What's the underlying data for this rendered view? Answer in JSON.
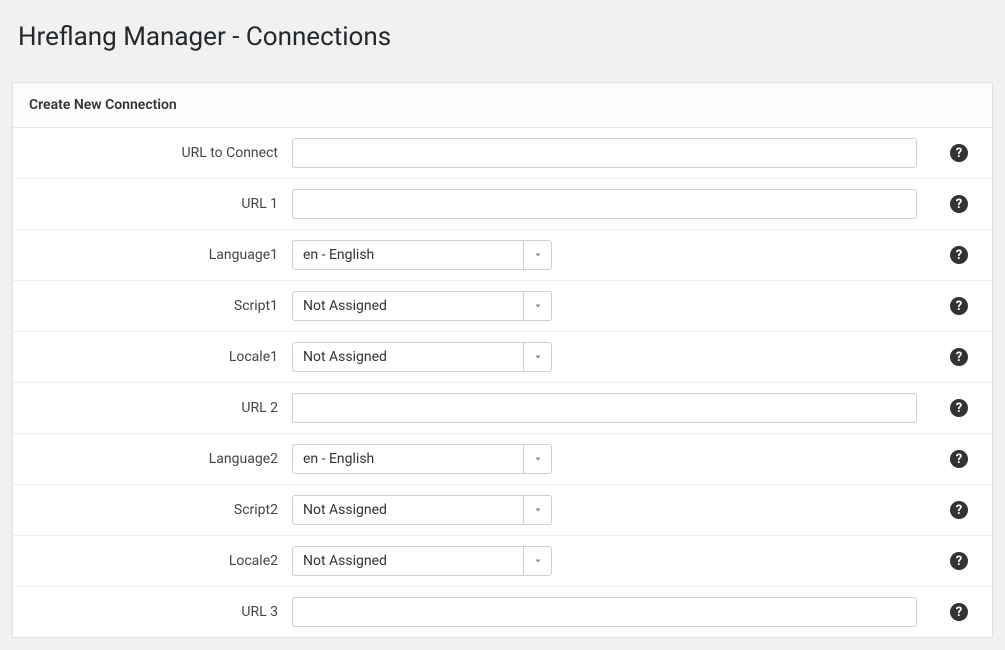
{
  "page": {
    "title": "Hreflang Manager - Connections"
  },
  "panel": {
    "heading": "Create New Connection"
  },
  "options": {
    "language_default": "en - English",
    "not_assigned": "Not Assigned"
  },
  "fields": [
    {
      "key": "url_to_connect",
      "label": "URL to Connect",
      "type": "text",
      "value": ""
    },
    {
      "key": "url1",
      "label": "URL 1",
      "type": "text",
      "value": ""
    },
    {
      "key": "language1",
      "label": "Language1",
      "type": "select",
      "value": "en - English"
    },
    {
      "key": "script1",
      "label": "Script1",
      "type": "select",
      "value": "Not Assigned"
    },
    {
      "key": "locale1",
      "label": "Locale1",
      "type": "select",
      "value": "Not Assigned"
    },
    {
      "key": "url2",
      "label": "URL 2",
      "type": "text",
      "value": ""
    },
    {
      "key": "language2",
      "label": "Language2",
      "type": "select",
      "value": "en - English"
    },
    {
      "key": "script2",
      "label": "Script2",
      "type": "select",
      "value": "Not Assigned"
    },
    {
      "key": "locale2",
      "label": "Locale2",
      "type": "select",
      "value": "Not Assigned"
    },
    {
      "key": "url3",
      "label": "URL 3",
      "type": "text",
      "value": ""
    }
  ]
}
